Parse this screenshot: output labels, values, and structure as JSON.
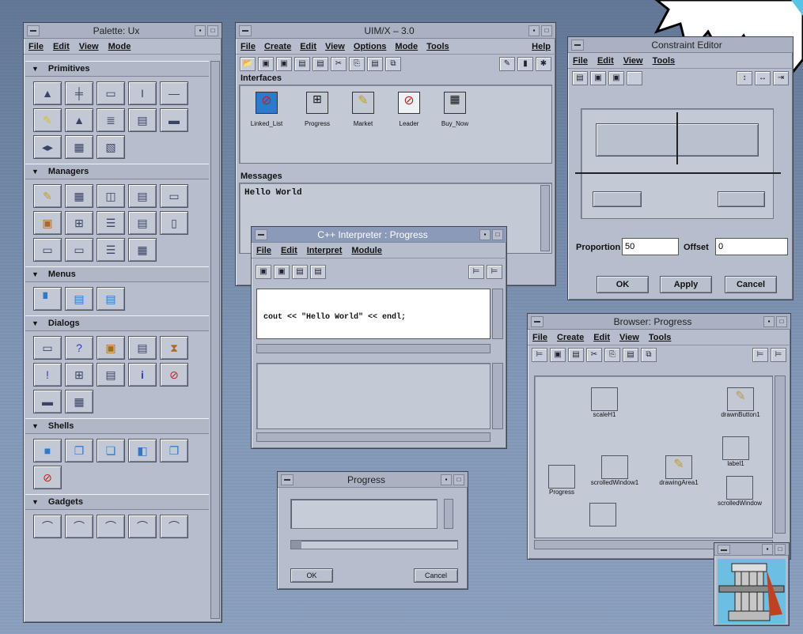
{
  "palette": {
    "title": "Palette: Ux",
    "menu": [
      "File",
      "Edit",
      "View",
      "Mode"
    ],
    "sections": [
      "Primitives",
      "Managers",
      "Menus",
      "Dialogs",
      "Shells",
      "Gadgets"
    ]
  },
  "uimx": {
    "title": "UIM/X – 3.0",
    "menu": [
      "File",
      "Create",
      "Edit",
      "View",
      "Options",
      "Mode",
      "Tools",
      "Help"
    ],
    "interfaces_label": "Interfaces",
    "interfaces": [
      "Linked_List",
      "Progress",
      "Market",
      "Leader",
      "Buy_Now"
    ],
    "messages_label": "Messages",
    "message_text": "Hello World"
  },
  "cpp": {
    "title": "C++ Interpreter : Progress",
    "menu": [
      "File",
      "Edit",
      "Interpret",
      "Module"
    ],
    "code": "cout << \"Hello World\" << endl;"
  },
  "constraint": {
    "title": "Constraint Editor",
    "menu": [
      "File",
      "Edit",
      "View",
      "Tools"
    ],
    "proportion_label": "Proportion",
    "proportion_value": "50",
    "offset_label": "Offset",
    "offset_value": "0",
    "ok": "OK",
    "apply": "Apply",
    "cancel": "Cancel"
  },
  "browser": {
    "title": "Browser: Progress",
    "menu": [
      "File",
      "Create",
      "Edit",
      "View",
      "Tools"
    ],
    "nodes": [
      "scaleH1",
      "drawnButton1",
      "label1",
      "Progress",
      "scrolledWindow1",
      "drawingArea1",
      "scrolledWindow"
    ]
  },
  "progress": {
    "title": "Progress",
    "ok": "OK",
    "cancel": "Cancel",
    "fill": 0.06
  }
}
